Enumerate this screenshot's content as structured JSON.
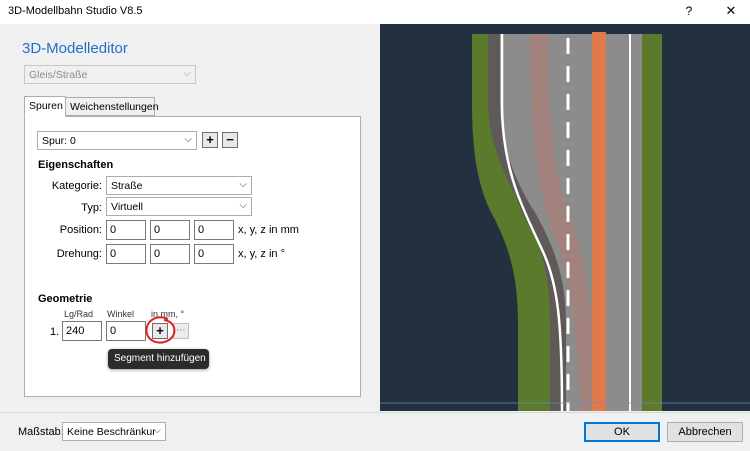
{
  "window": {
    "title": "3D-Modellbahn Studio V8.5",
    "help_label": "?",
    "close_label": "✕"
  },
  "editor": {
    "heading": "3D-Modelleditor",
    "mode_select": "Gleis/Straße"
  },
  "tabs": [
    {
      "label": "Spuren",
      "active": true
    },
    {
      "label": "Weichenstellungen",
      "active": false
    }
  ],
  "lane": {
    "select": "Spur: 0",
    "add_label": "+",
    "remove_label": "−"
  },
  "properties": {
    "heading": "Eigenschaften",
    "category_label": "Kategorie:",
    "category_value": "Straße",
    "type_label": "Typ:",
    "type_value": "Virtuell",
    "position_label": "Position:",
    "position_values": [
      "0",
      "0",
      "0"
    ],
    "position_unit": "x, y, z in mm",
    "rotation_label": "Drehung:",
    "rotation_values": [
      "0",
      "0",
      "0"
    ],
    "rotation_unit": "x, y, z in °"
  },
  "geometry": {
    "heading": "Geometrie",
    "col_length": "Lg/Rad",
    "col_angle": "Winkel",
    "col_unit": "in mm, °",
    "rows": [
      {
        "index": "1.",
        "length": "240",
        "angle": "0"
      }
    ],
    "add_label": "+",
    "more_label": "···",
    "tooltip": "Segment hinzufügen"
  },
  "colors": {
    "accent": "#1e6fc8",
    "annotation": "#e0201c",
    "grass": "#5c7a2c",
    "asphalt": "#8c8c8c",
    "orange_track": "#e07a4a"
  },
  "footer": {
    "scale_label": "Maßstab:",
    "scale_value": "Keine Beschränkung",
    "ok_label": "OK",
    "cancel_label": "Abbrechen"
  }
}
